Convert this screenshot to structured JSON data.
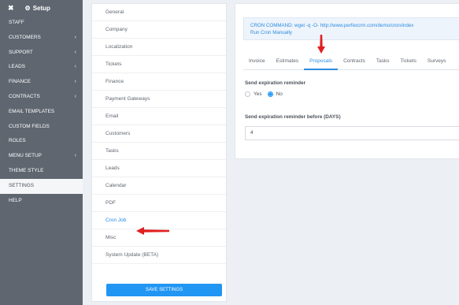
{
  "sidebar": {
    "title": "Setup",
    "items": [
      {
        "label": "STAFF",
        "chevron": false
      },
      {
        "label": "CUSTOMERS",
        "chevron": true
      },
      {
        "label": "SUPPORT",
        "chevron": true
      },
      {
        "label": "LEADS",
        "chevron": true
      },
      {
        "label": "FINANCE",
        "chevron": true
      },
      {
        "label": "CONTRACTS",
        "chevron": true
      },
      {
        "label": "EMAIL TEMPLATES",
        "chevron": false
      },
      {
        "label": "CUSTOM FIELDS",
        "chevron": false
      },
      {
        "label": "ROLES",
        "chevron": false
      },
      {
        "label": "MENU SETUP",
        "chevron": true
      },
      {
        "label": "THEME STYLE",
        "chevron": false
      },
      {
        "label": "SETTINGS",
        "chevron": false,
        "active": true
      },
      {
        "label": "HELP",
        "chevron": false
      }
    ]
  },
  "settings_menu": {
    "items": [
      "General",
      "Company",
      "Localization",
      "Tickets",
      "Finance",
      "Payment Gateways",
      "Email",
      "Customers",
      "Tasks",
      "Leads",
      "Calendar",
      "PDF",
      "Cron Job",
      "Misc",
      "System Update (BETA)"
    ],
    "active_index": 12,
    "save_label": "SAVE SETTINGS"
  },
  "cron": {
    "command": "CRON COMMAND: wget -q -O- http://www.perfexcrm.com/demo/cron/index",
    "run_label": "Run Cron Manually"
  },
  "tabs": {
    "items": [
      "Invoice",
      "Estimates",
      "Proposals",
      "Contracts",
      "Tasks",
      "Tickets",
      "Surveys"
    ],
    "active_index": 2
  },
  "form": {
    "reminder_label": "Send expiration reminder",
    "yes_label": "Yes",
    "no_label": "No",
    "selected": "No",
    "days_label": "Send expiration reminder before (DAYS)",
    "days_value": "4"
  },
  "colors": {
    "sidebar_bg": "#5f6670",
    "accent": "#2196f3",
    "annotation_arrow": "#e02020"
  }
}
